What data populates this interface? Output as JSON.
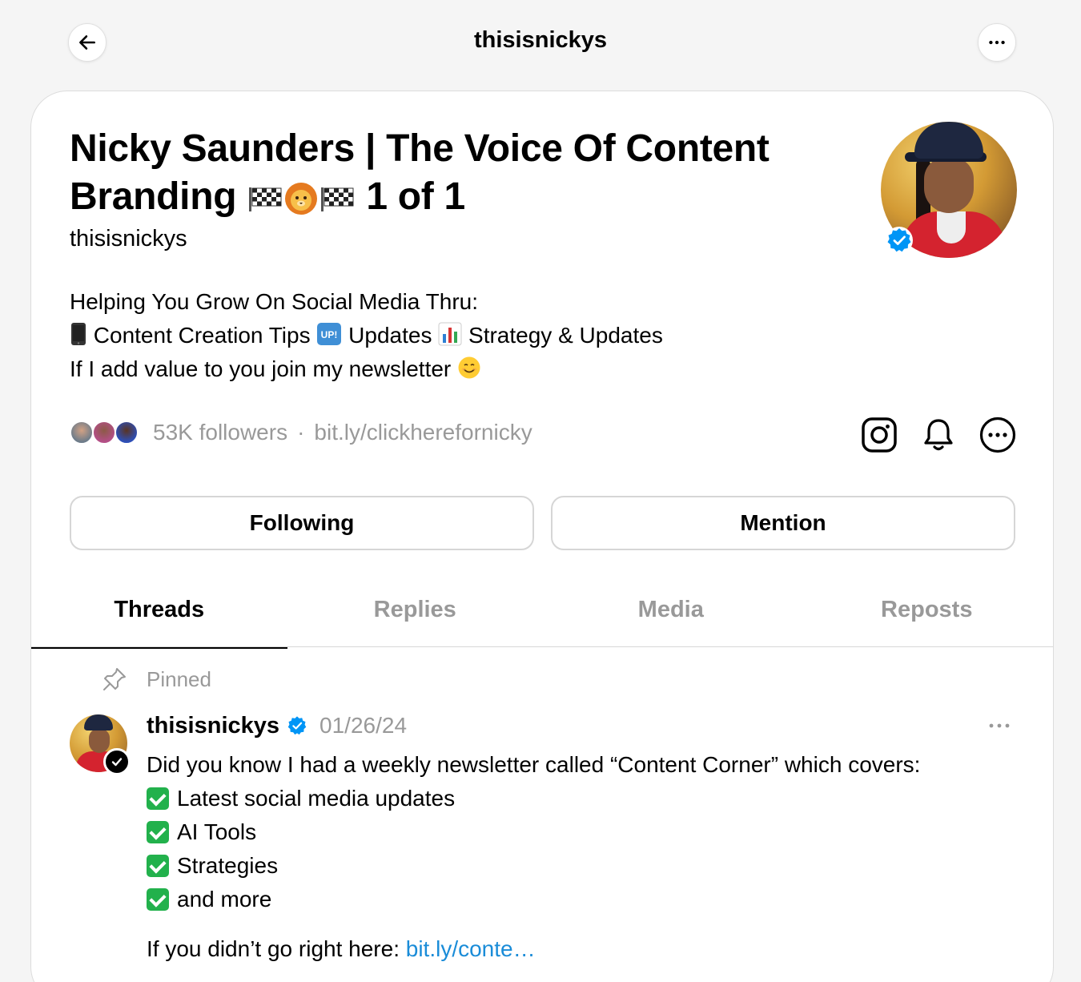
{
  "header": {
    "title": "thisisnickys"
  },
  "profile": {
    "name_part1": "Nicky Saunders | The Voice Of Content Branding",
    "name_part2": "1 of 1",
    "handle": "thisisnickys",
    "bio": {
      "line1": "Helping You Grow On Social Media Thru:",
      "line2_a": "Content Creation Tips",
      "line2_b": "Updates",
      "line2_c": "Strategy & Updates",
      "line3": "If I add value to you join my newsletter"
    },
    "followers": "53K followers",
    "separator": "·",
    "link": "bit.ly/clickherefornicky"
  },
  "actions": {
    "following_label": "Following",
    "mention_label": "Mention"
  },
  "tabs": [
    {
      "label": "Threads",
      "active": true
    },
    {
      "label": "Replies",
      "active": false
    },
    {
      "label": "Media",
      "active": false
    },
    {
      "label": "Reposts",
      "active": false
    }
  ],
  "post": {
    "pinned_label": "Pinned",
    "username": "thisisnickys",
    "date": "01/26/24",
    "line1": "Did you know I had a weekly newsletter called “Content Corner” which covers:",
    "items": [
      "Latest social media updates",
      "AI Tools",
      "Strategies",
      "and more"
    ],
    "cta_text": "If you didn’t go right here: ",
    "cta_link": "bit.ly/conte…"
  },
  "colors": {
    "verified": "#0095f6",
    "link": "#1a8cd8",
    "muted": "#999999",
    "check": "#22b14c"
  },
  "icons": [
    "back-arrow-icon",
    "more-icon",
    "instagram-icon",
    "bell-icon",
    "more-circle-icon",
    "pin-icon",
    "verified-icon"
  ]
}
